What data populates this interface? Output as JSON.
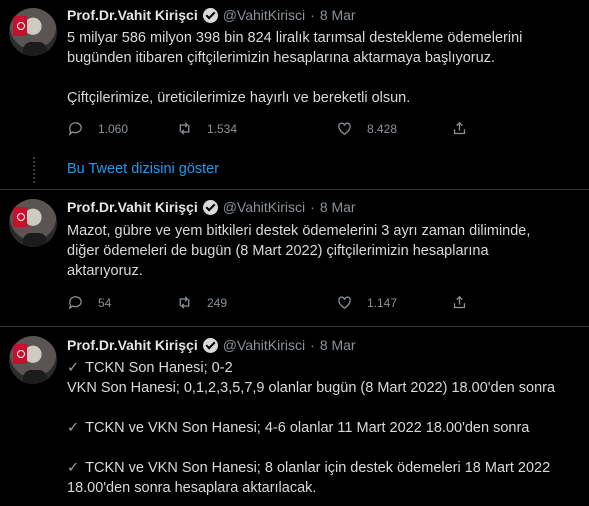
{
  "show_thread_label": "Bu Tweet dizisini göster",
  "tweets": [
    {
      "name": "Prof.Dr.Vahit Kirişci",
      "handle": "@VahitKirisci",
      "date": "8 Mar",
      "lines": [
        "5 milyar 586 milyon 398 bin 824 liralık tarımsal destekleme ödemelerini",
        "bugünden itibaren çiftçilerimizin hesaplarına aktarmaya başlıyoruz.",
        "Çiftçilerimize, üreticilerimize hayırlı ve bereketli olsun."
      ],
      "replies": "1.060",
      "retweets": "1.534",
      "likes": "8.428"
    },
    {
      "name": "Prof.Dr.Vahit Kirişçi",
      "handle": "@VahitKirisci",
      "date": "8 Mar",
      "lines": [
        "Mazot, gübre ve yem bitkileri destek ödemelerini 3 ayrı zaman diliminde,",
        "diğer ödemeleri de bugün (8 Mart 2022) çiftçilerimizin hesaplarına",
        "aktarıyoruz."
      ],
      "replies": "54",
      "retweets": "249",
      "likes": "1.147"
    },
    {
      "name": "Prof.Dr.Vahit Kirişçi",
      "handle": "@VahitKirisci",
      "date": "8 Mar",
      "lines": [
        "TCKN Son Hanesi; 0-2",
        "VKN Son Hanesi; 0,1,2,3,5,7,9 olanlar bugün (8 Mart 2022) 18.00'den sonra",
        "TCKN ve VKN Son Hanesi; 4-6 olanlar 11 Mart 2022 18.00'den sonra",
        "TCKN ve VKN Son Hanesi; 8 olanlar için destek ödemeleri 18 Mart 2022",
        "18.00'den sonra hesaplara aktarılacak."
      ],
      "checkmark": "✓"
    }
  ]
}
